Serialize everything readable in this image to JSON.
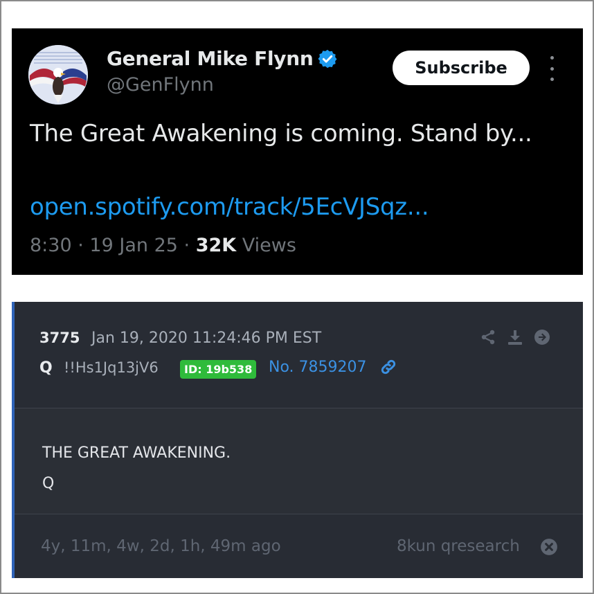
{
  "tweet": {
    "display_name": "General Mike Flynn",
    "handle": "@GenFlynn",
    "subscribe_label": "Subscribe",
    "text": "The Great Awakening is coming. Stand by...",
    "link": "open.spotify.com/track/5EcVJSqz...",
    "time": "8:30",
    "date": "19 Jan 25",
    "views_count": "32K",
    "views_label": "Views",
    "separator": "·",
    "verified_color": "#1d9bf0",
    "link_color": "#1d9bf0"
  },
  "qdrop": {
    "number": "3775",
    "datetime": "Jan 19, 2020 11:24:46 PM EST",
    "name": "Q",
    "tripcode": "!!Hs1Jq13jV6",
    "id_badge": "ID: 19b538",
    "post_number": "No. 7859207",
    "body_line1": "THE GREAT AWAKENING.",
    "body_line2": "Q",
    "age": "4y, 11m, 4w, 2d, 1h, 49m ago",
    "source": "8kun qresearch",
    "id_color": "#2fbb3b",
    "post_link_color": "#3b91e3",
    "icons": [
      "share-icon",
      "download-icon",
      "arrow-right-circle-icon",
      "link-icon",
      "close-circle-icon"
    ]
  }
}
